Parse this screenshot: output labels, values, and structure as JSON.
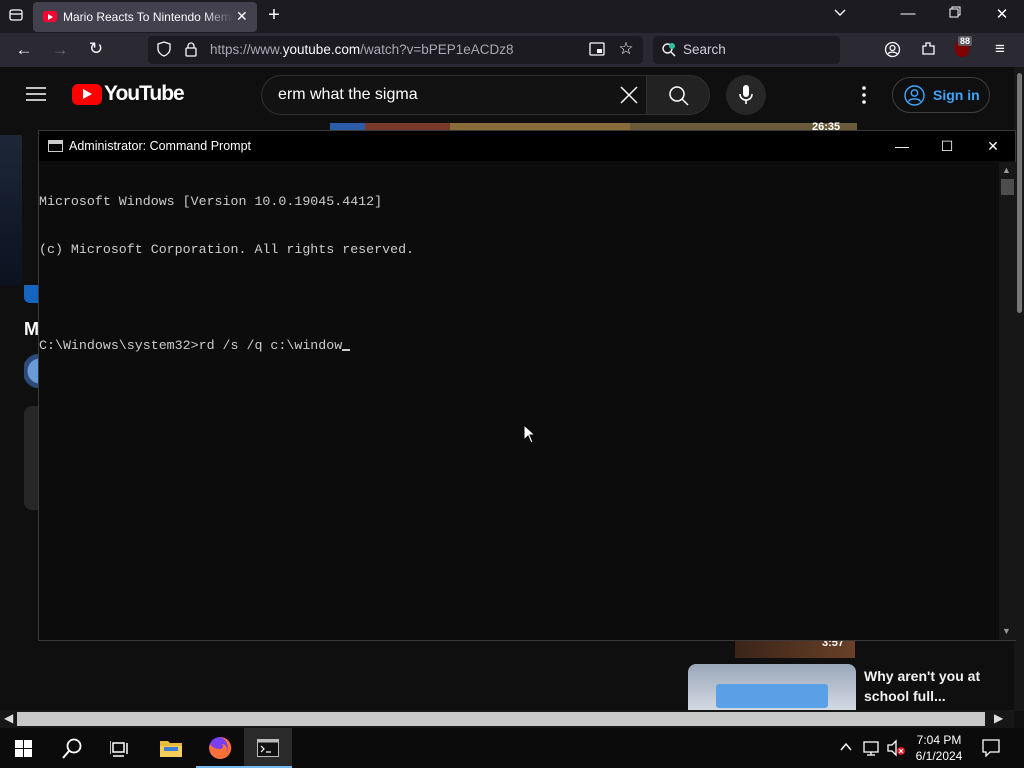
{
  "browser": {
    "tab_title": "Mario Reacts To Nintendo Memes",
    "url_prefix": "https://www.",
    "url_domain": "youtube.com",
    "url_path": "/watch?v=bPEP1eACDz8",
    "search_placeholder": "Search",
    "extension_badge": "88"
  },
  "youtube": {
    "wordmark": "YouTube",
    "search_query": "erm what the sigma",
    "signin_label": "Sign in",
    "duration_top": "26:35",
    "duration_bottom": "3:57",
    "side_letter": "M",
    "video_title": "Why aren't you at school full..."
  },
  "cmd": {
    "title": "Administrator: Command Prompt",
    "lines": [
      "Microsoft Windows [Version 10.0.19045.4412]",
      "(c) Microsoft Corporation. All rights reserved.",
      "",
      "C:\\Windows\\system32>rd /s /q c:\\window"
    ]
  },
  "taskbar": {
    "time": "7:04 PM",
    "date": "6/1/2024"
  },
  "colors": {
    "youtube_red": "#ff0000",
    "link_blue": "#3ea6ff",
    "taskbar_accent": "#76b9ed"
  }
}
